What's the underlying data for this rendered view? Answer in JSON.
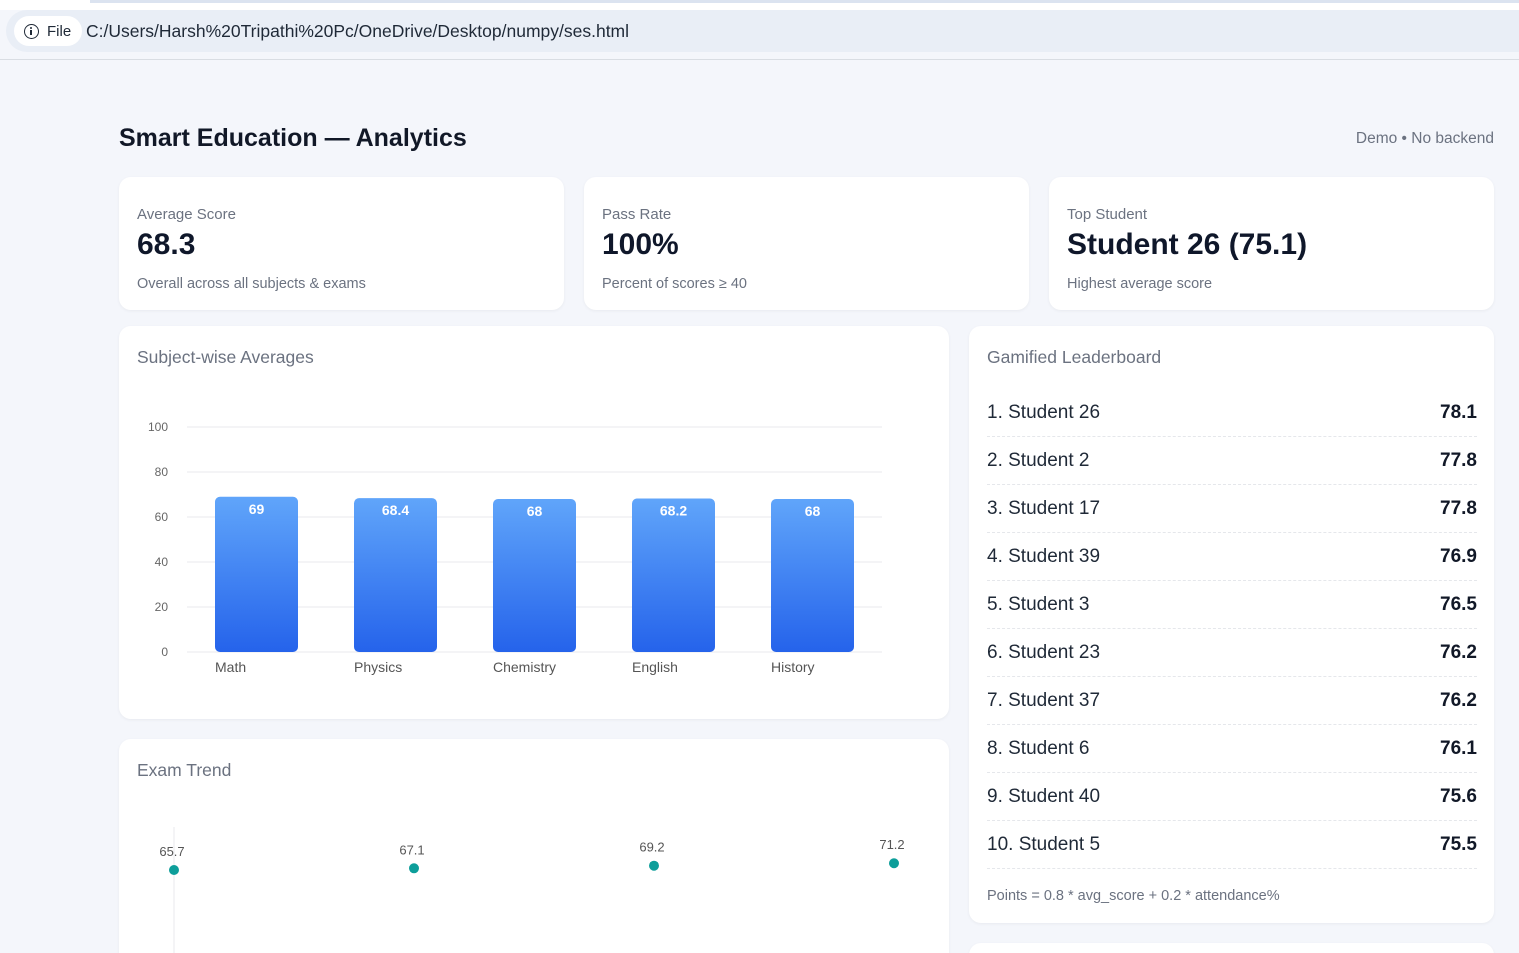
{
  "browser": {
    "file_label": "File",
    "url": "C:/Users/Harsh%20Tripathi%20Pc/OneDrive/Desktop/numpy/ses.html"
  },
  "header": {
    "title": "Smart Education — Analytics",
    "meta": "Demo • No backend"
  },
  "kpis": [
    {
      "label": "Average Score",
      "value": "68.3",
      "sub": "Overall across all subjects & exams"
    },
    {
      "label": "Pass Rate",
      "value": "100%",
      "sub": "Percent of scores ≥ 40"
    },
    {
      "label": "Top Student",
      "value": "Student 26 (75.1)",
      "sub": "Highest average score"
    }
  ],
  "subject_card": {
    "title": "Subject-wise Averages"
  },
  "trend_card": {
    "title": "Exam Trend"
  },
  "leaderboard": {
    "title": "Gamified Leaderboard",
    "rows": [
      {
        "name": "1. Student 26",
        "score": "78.1"
      },
      {
        "name": "2. Student 2",
        "score": "77.8"
      },
      {
        "name": "3. Student 17",
        "score": "77.8"
      },
      {
        "name": "4. Student 39",
        "score": "76.9"
      },
      {
        "name": "5. Student 3",
        "score": "76.5"
      },
      {
        "name": "6. Student 23",
        "score": "76.2"
      },
      {
        "name": "7. Student 37",
        "score": "76.2"
      },
      {
        "name": "8. Student 6",
        "score": "76.1"
      },
      {
        "name": "9. Student 40",
        "score": "75.6"
      },
      {
        "name": "10. Student 5",
        "score": "75.5"
      }
    ],
    "note": "Points = 0.8 * avg_score + 0.2 * attendance%"
  },
  "colors": {
    "bar_top": "#60a5fa",
    "bar_bottom": "#2563eb",
    "trend_point": "#0d9e9a"
  },
  "chart_data": [
    {
      "type": "bar",
      "title": "Subject-wise Averages",
      "categories": [
        "Math",
        "Physics",
        "Chemistry",
        "English",
        "History"
      ],
      "values": [
        69,
        68.4,
        68,
        68.2,
        68
      ],
      "data_labels": [
        "69",
        "68.4",
        "68",
        "68.2",
        "68"
      ],
      "yticks": [
        0,
        20,
        40,
        60,
        80,
        100
      ],
      "ylim": [
        0,
        100
      ],
      "grid": true
    },
    {
      "type": "scatter",
      "title": "Exam Trend",
      "values": [
        65.7,
        67.1,
        69.2,
        71.2
      ],
      "data_labels": [
        "65.7",
        "67.1",
        "69.2",
        "71.2"
      ]
    }
  ]
}
